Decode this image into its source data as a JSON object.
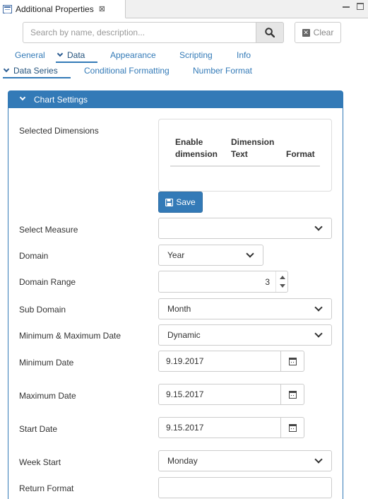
{
  "view": {
    "title": "Additional Properties",
    "close_glyph": "⊠"
  },
  "search": {
    "placeholder": "Search by name, description...",
    "clear_label": "Clear"
  },
  "tabs": [
    {
      "label": "General",
      "active": false
    },
    {
      "label": "Data",
      "active": true
    },
    {
      "label": "Appearance",
      "active": false
    },
    {
      "label": "Scripting",
      "active": false
    },
    {
      "label": "Info",
      "active": false
    }
  ],
  "subtabs": [
    {
      "label": "Data Series",
      "active": true
    },
    {
      "label": "Conditional Formatting",
      "active": false
    },
    {
      "label": "Number Format",
      "active": false
    }
  ],
  "panel": {
    "title": "Chart Settings",
    "selected_dimensions_label": "Selected Dimensions",
    "dimension_columns": [
      {
        "line1": "Enable",
        "line2": "dimension"
      },
      {
        "line1": "Dimension",
        "line2": "Text"
      },
      {
        "line1": "",
        "line2": "Format"
      }
    ],
    "save_label": "Save",
    "fields": {
      "select_measure": {
        "label": "Select Measure",
        "value": ""
      },
      "domain": {
        "label": "Domain",
        "value": "Year"
      },
      "domain_range": {
        "label": "Domain Range",
        "value": "3"
      },
      "sub_domain": {
        "label": "Sub Domain",
        "value": "Month"
      },
      "min_max_date": {
        "label": "Minimum & Maximum Date",
        "value": "Dynamic"
      },
      "minimum_date": {
        "label": "Minimum Date",
        "value": "9.19.2017"
      },
      "maximum_date": {
        "label": "Maximum Date",
        "value": "9.15.2017"
      },
      "start_date": {
        "label": "Start Date",
        "value": "9.15.2017"
      },
      "week_start": {
        "label": "Week Start",
        "value": "Monday"
      },
      "return_format": {
        "label": "Return Format",
        "value": ""
      }
    }
  },
  "colors": {
    "accent": "#337ab7",
    "link": "#337ab7",
    "border": "#cccccc"
  }
}
